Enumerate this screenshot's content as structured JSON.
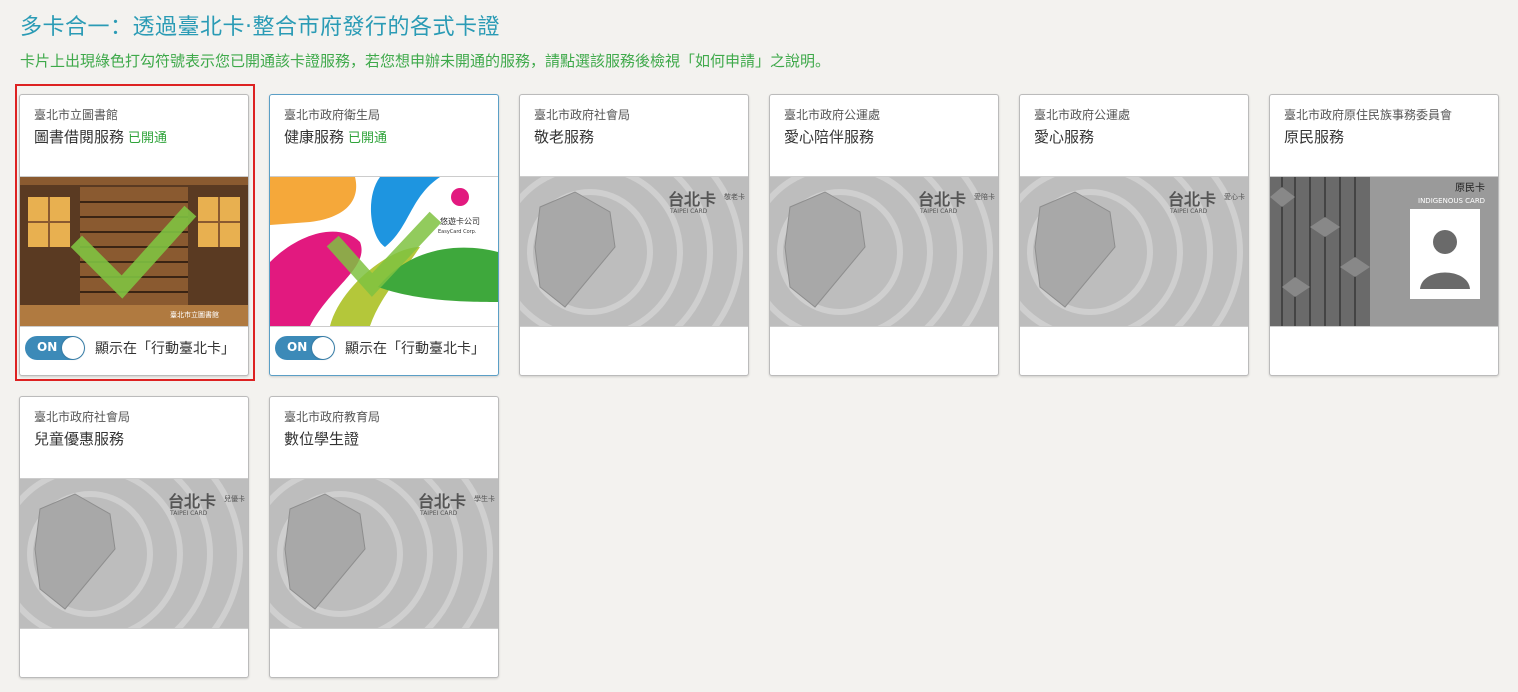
{
  "header": {
    "title": "多卡合一：透過臺北卡‧整合市府發行的各式卡證",
    "subtitle": "卡片上出現綠色打勾符號表示您已開通該卡證服務，若您想申辦未開通的服務，請點選該服務後檢視「如何申請」之說明。"
  },
  "colors": {
    "title": "#2a9bb5",
    "subtitle": "#3ea94a",
    "opened": "#2fa33a",
    "toggle": "#3c8ab8",
    "highlight": "#dd2222"
  },
  "cards": [
    {
      "agency": "臺北市立圖書館",
      "service": "圖書借閱服務",
      "opened_label": "已開通",
      "toggle_state": "ON",
      "toggle_label": "顯示在「行動臺北卡」",
      "card_type": "library-card",
      "checked": true,
      "card_text": "臺北市立圖書館"
    },
    {
      "agency": "臺北市政府衛生局",
      "service": "健康服務",
      "opened_label": "已開通",
      "toggle_state": "ON",
      "toggle_label": "顯示在「行動臺北卡」",
      "card_type": "easycard",
      "checked": true,
      "card_text": "悠遊卡公司",
      "card_text2": "EasyCard Corp."
    },
    {
      "agency": "臺北市政府社會局",
      "service": "敬老服務",
      "card_type": "taipei-card",
      "card_text": "敬老卡"
    },
    {
      "agency": "臺北市政府公運處",
      "service": "愛心陪伴服務",
      "card_type": "taipei-card",
      "card_text": "愛陪卡"
    },
    {
      "agency": "臺北市政府公運處",
      "service": "愛心服務",
      "card_type": "taipei-card",
      "card_text": "愛心卡"
    },
    {
      "agency": "臺北市政府原住民族事務委員會",
      "service": "原民服務",
      "card_type": "indigenous-card",
      "card_text": "原民卡",
      "card_text2": "INDIGENOUS CARD"
    },
    {
      "agency": "臺北市政府社會局",
      "service": "兒童優惠服務",
      "card_type": "taipei-card",
      "card_text": "兒優卡"
    },
    {
      "agency": "臺北市政府教育局",
      "service": "數位學生證",
      "card_type": "taipei-card",
      "card_text": "學生卡"
    }
  ],
  "taipei_card_logo": "台北卡",
  "taipei_card_en": "TAIPEI CARD"
}
